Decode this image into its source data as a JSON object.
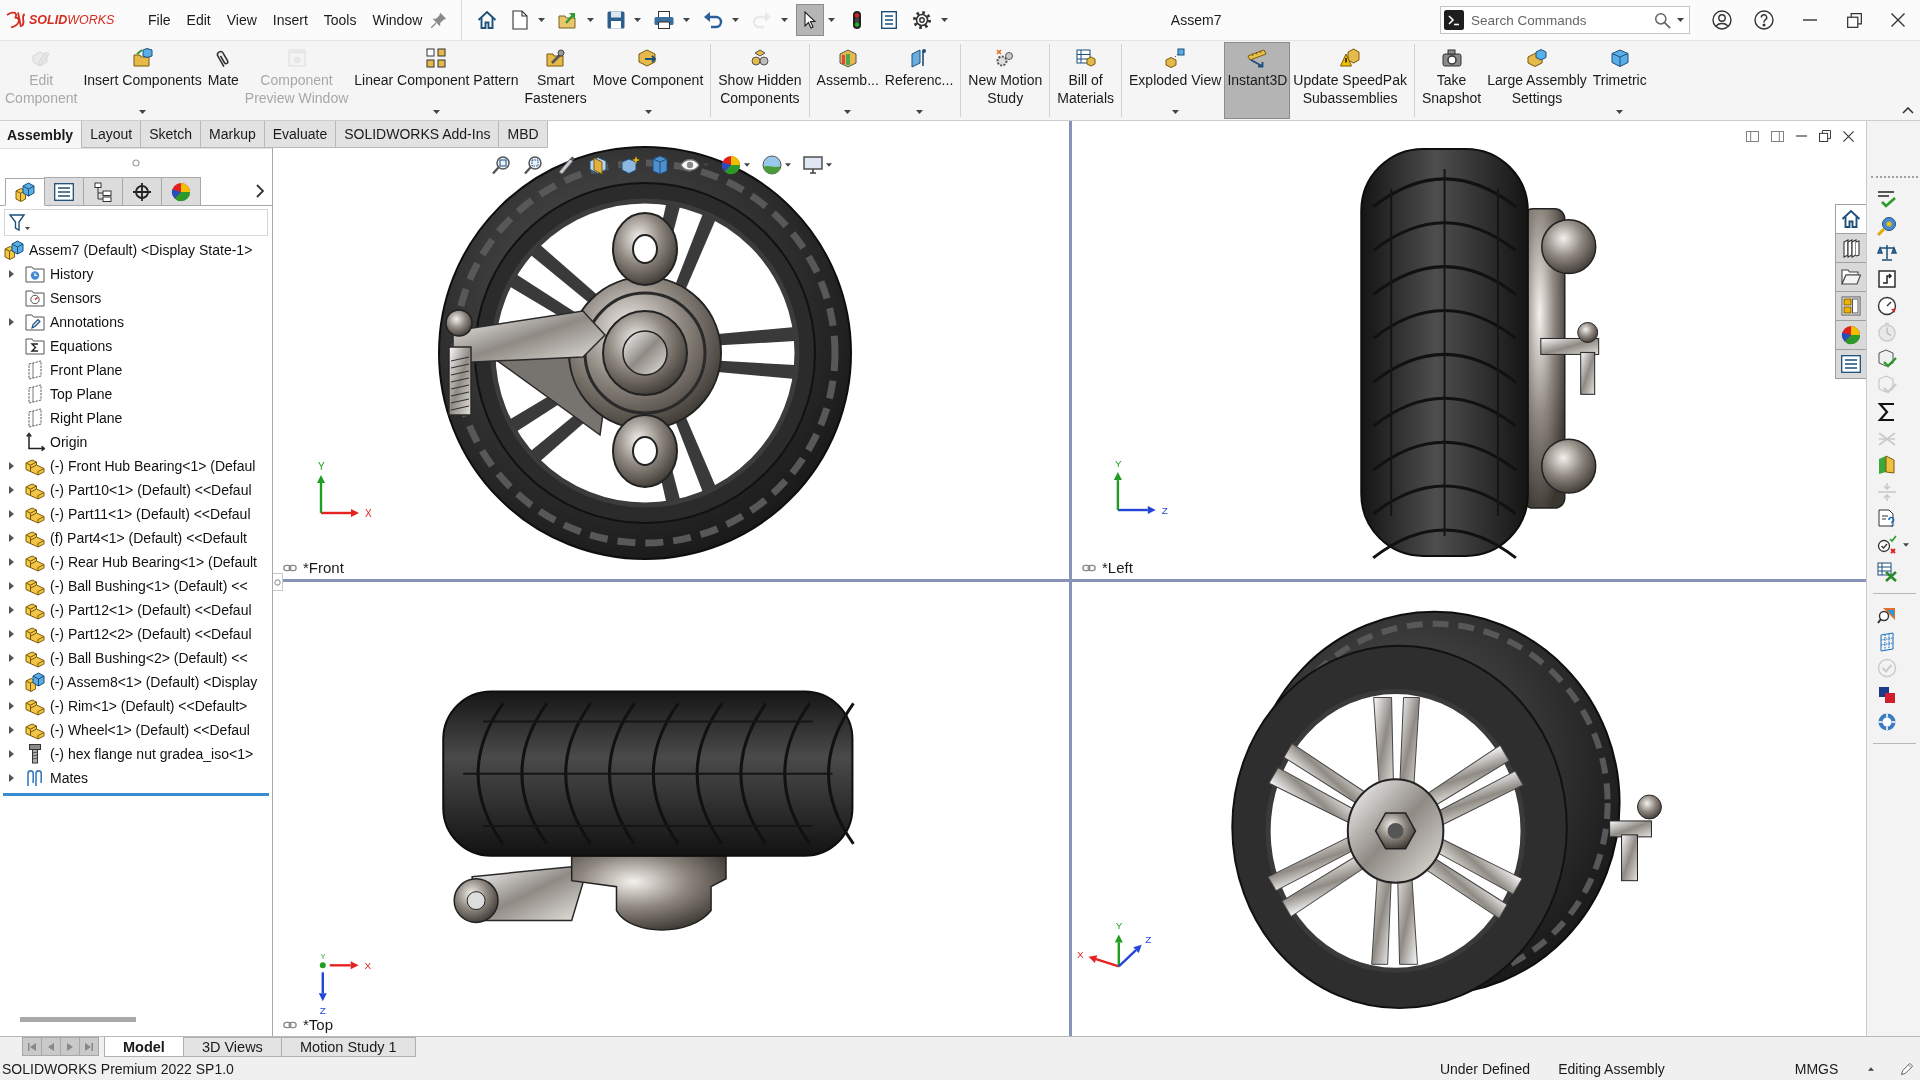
{
  "title_bar": {
    "logo": "**SOLID**WORKS",
    "menu": [
      "File",
      "Edit",
      "View",
      "Insert",
      "Tools",
      "Window"
    ],
    "quick_access": [
      {
        "dropdown": false,
        "selected": false,
        "disabled": false
      },
      {
        "dropdown": true,
        "selected": false,
        "disabled": false
      },
      {
        "dropdown": true,
        "selected": false,
        "disabled": false
      },
      {
        "dropdown": true,
        "selected": false,
        "disabled": false
      },
      {
        "dropdown": true,
        "selected": false,
        "disabled": false
      },
      {
        "dropdown": true,
        "selected": false,
        "disabled": false
      },
      {
        "dropdown": true,
        "selected": false,
        "disabled": true
      },
      {
        "dropdown": true,
        "selected": true,
        "disabled": false
      },
      {
        "dropdown": false,
        "selected": false,
        "disabled": false
      },
      {
        "dropdown": false,
        "selected": false,
        "disabled": false
      },
      {
        "dropdown": true,
        "selected": false,
        "disabled": false
      }
    ],
    "document_title": "Assem7",
    "search": {
      "placeholder": "Search Commands"
    }
  },
  "ribbon": {
    "groups": [
      [
        {
          "label": "Edit\nComponent",
          "disabled": true,
          "selected": false,
          "dropdown": false
        },
        {
          "label": "Insert Components",
          "disabled": false,
          "selected": false,
          "dropdown": true
        },
        {
          "label": "Mate",
          "disabled": false,
          "selected": false,
          "dropdown": false
        },
        {
          "label": "Component\nPreview Window",
          "disabled": true,
          "selected": false,
          "dropdown": false
        },
        {
          "label": "Linear Component Pattern",
          "disabled": false,
          "selected": false,
          "dropdown": true
        },
        {
          "label": "Smart\nFasteners",
          "disabled": false,
          "selected": false,
          "dropdown": false
        },
        {
          "label": "Move Component",
          "disabled": false,
          "selected": false,
          "dropdown": true
        }
      ],
      [
        {
          "label": "Show Hidden\nComponents",
          "disabled": false,
          "selected": false,
          "dropdown": false
        }
      ],
      [
        {
          "label": "Assemb...",
          "disabled": false,
          "selected": false,
          "dropdown": true
        },
        {
          "label": "Referenc...",
          "disabled": false,
          "selected": false,
          "dropdown": true
        }
      ],
      [
        {
          "label": "New Motion\nStudy",
          "disabled": false,
          "selected": false,
          "dropdown": false
        }
      ],
      [
        {
          "label": "Bill of\nMaterials",
          "disabled": false,
          "selected": false,
          "dropdown": false
        }
      ],
      [
        {
          "label": "Exploded View",
          "disabled": false,
          "selected": false,
          "dropdown": true
        },
        {
          "label": "Instant3D",
          "disabled": false,
          "selected": true,
          "dropdown": false
        },
        {
          "label": "Update SpeedPak\nSubassemblies",
          "disabled": false,
          "selected": false,
          "dropdown": false
        }
      ],
      [
        {
          "label": "Take\nSnapshot",
          "disabled": false,
          "selected": false,
          "dropdown": false
        },
        {
          "label": "Large Assembly\nSettings",
          "disabled": false,
          "selected": false,
          "dropdown": false
        },
        {
          "label": "Trimetric",
          "disabled": false,
          "selected": false,
          "dropdown": true
        }
      ]
    ]
  },
  "command_tabs": [
    {
      "label": "Assembly",
      "selected": true
    },
    {
      "label": "Layout",
      "selected": false
    },
    {
      "label": "Sketch",
      "selected": false
    },
    {
      "label": "Markup",
      "selected": false
    },
    {
      "label": "Evaluate",
      "selected": false
    },
    {
      "label": "SOLIDWORKS Add-Ins",
      "selected": false
    },
    {
      "label": "MBD",
      "selected": false
    }
  ],
  "feature_manager": {
    "tabs": [
      {
        "selected": true
      },
      {
        "selected": false
      },
      {
        "selected": false
      },
      {
        "selected": false
      },
      {
        "selected": false
      }
    ],
    "tree": {
      "label": "Assem7 (Default) <Display State-1>",
      "kind": "assembly",
      "children": [
        {
          "label": "History",
          "kind": "history",
          "expandable": true
        },
        {
          "label": "Sensors",
          "kind": "sensors",
          "expandable": false
        },
        {
          "label": "Annotations",
          "kind": "annotations",
          "expandable": true
        },
        {
          "label": "Equations",
          "kind": "equations",
          "expandable": false
        },
        {
          "label": "Front Plane",
          "kind": "plane",
          "expandable": false
        },
        {
          "label": "Top Plane",
          "kind": "plane",
          "expandable": false
        },
        {
          "label": "Right Plane",
          "kind": "plane",
          "expandable": false
        },
        {
          "label": "Origin",
          "kind": "origin",
          "expandable": false
        },
        {
          "label": "(-) Front Hub Bearing<1> (Defaul",
          "kind": "part",
          "expandable": true
        },
        {
          "label": "(-) Part10<1> (Default) <<Defaul",
          "kind": "part",
          "expandable": true
        },
        {
          "label": "(-) Part11<1> (Default) <<Defaul",
          "kind": "part",
          "expandable": true
        },
        {
          "label": "(f) Part4<1> (Default) <<Default",
          "kind": "part",
          "expandable": true
        },
        {
          "label": "(-) Rear Hub Bearing<1> (Default",
          "kind": "part",
          "expandable": true
        },
        {
          "label": "(-) Ball Bushing<1> (Default) <<",
          "kind": "part",
          "expandable": true
        },
        {
          "label": "(-) Part12<1> (Default) <<Defaul",
          "kind": "part",
          "expandable": true
        },
        {
          "label": "(-) Part12<2> (Default) <<Defaul",
          "kind": "part",
          "expandable": true
        },
        {
          "label": "(-) Ball Bushing<2> (Default) <<",
          "kind": "part",
          "expandable": true
        },
        {
          "label": "(-) Assem8<1> (Default) <Display",
          "kind": "assembly",
          "expandable": true
        },
        {
          "label": "(-) Rim<1> (Default) <<Default>",
          "kind": "part",
          "expandable": true
        },
        {
          "label": "(-) Wheel<1> (Default) <<Defaul",
          "kind": "part",
          "expandable": true
        },
        {
          "label": "(-) hex flange nut gradea_iso<1>",
          "kind": "hardware",
          "expandable": true
        },
        {
          "label": "Mates",
          "kind": "mates",
          "expandable": true
        }
      ]
    }
  },
  "viewports": [
    {
      "kind": "front",
      "label": "*Front",
      "triad": [
        {
          "kind": "y",
          "label": "Y"
        },
        {
          "kind": "x",
          "label": "X"
        }
      ]
    },
    {
      "kind": "left",
      "label": "*Left",
      "triad": [
        {
          "kind": "y",
          "label": "Y"
        },
        {
          "kind": "z",
          "label": "Z"
        }
      ]
    },
    {
      "kind": "top",
      "label": "*Top",
      "triad": [
        {
          "kind": "y",
          "label": "Y"
        },
        {
          "kind": "x",
          "label": "X"
        },
        {
          "kind": "z",
          "label": "Z"
        }
      ]
    },
    {
      "kind": "trimetric",
      "triad": [
        {
          "kind": "x",
          "label": "X"
        },
        {
          "kind": "y",
          "label": "Y"
        },
        {
          "kind": "z",
          "label": "Z"
        }
      ]
    }
  ],
  "task_pane_tabs": [
    {
      "selected": true
    },
    {
      "selected": false
    },
    {
      "selected": false
    },
    {
      "selected": false
    },
    {
      "selected": false
    },
    {
      "selected": false
    }
  ],
  "tools_toolbar": [
    [
      {
        "disabled": false,
        "dropdown": false
      },
      {
        "disabled": false,
        "dropdown": false
      },
      {
        "disabled": false,
        "dropdown": false
      },
      {
        "disabled": false,
        "dropdown": false
      },
      {
        "disabled": false,
        "dropdown": false
      },
      {
        "disabled": true,
        "dropdown": false
      },
      {
        "disabled": false,
        "dropdown": false
      },
      {
        "disabled": true,
        "dropdown": false
      },
      {
        "disabled": false,
        "dropdown": false
      },
      {
        "disabled": true,
        "dropdown": false
      },
      {
        "disabled": false,
        "dropdown": false
      },
      {
        "disabled": true,
        "dropdown": false
      },
      {
        "disabled": false,
        "dropdown": false
      },
      {
        "disabled": false,
        "dropdown": true
      },
      {
        "disabled": false,
        "dropdown": false
      }
    ],
    [
      {
        "disabled": false,
        "dropdown": false
      },
      {
        "disabled": false,
        "dropdown": false
      },
      {
        "disabled": true,
        "dropdown": false
      },
      {
        "disabled": false,
        "dropdown": false
      },
      {
        "disabled": false,
        "dropdown": false
      }
    ]
  ],
  "bottom_tabs": [
    {
      "label": "Model",
      "selected": true
    },
    {
      "label": "3D Views",
      "selected": false
    },
    {
      "label": "Motion Study 1",
      "selected": false
    }
  ],
  "status_bar": {
    "product": "SOLIDWORKS Premium 2022 SP1.0",
    "rebuild_state": "Under Defined",
    "mode": "Editing Assembly",
    "units": "MMGS"
  }
}
